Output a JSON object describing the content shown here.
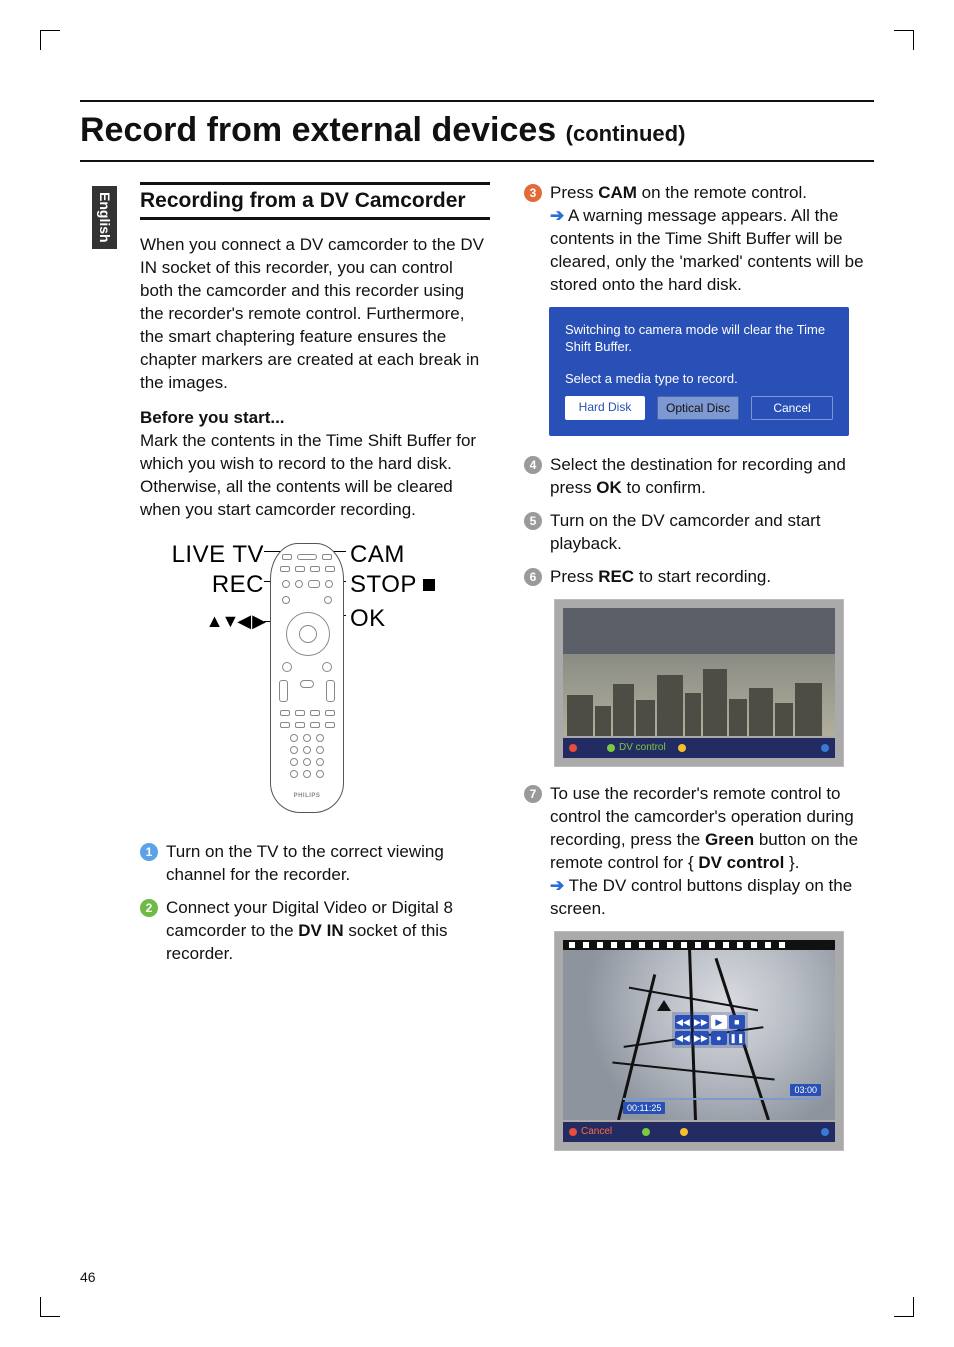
{
  "page": {
    "heading": "Record from external devices",
    "continued": "(continued)",
    "side_tab": "English",
    "page_number": "46"
  },
  "left": {
    "section_title": "Recording from a DV Camcorder",
    "intro": "When you connect a DV camcorder to the DV IN socket of this recorder, you can control both the camcorder and this recorder using the recorder's remote control. Furthermore, the smart chaptering feature ensures the chapter markers are created at each break in the images.",
    "before_title": "Before you start...",
    "before_text": "Mark the contents in the Time Shift Buffer for which you wish to record to the hard disk. Otherwise, all the contents will be cleared when you start camcorder recording.",
    "callouts": {
      "livetv": "LIVE TV",
      "rec": "REC",
      "nav": "▲▼◀ ▶",
      "cam": "CAM",
      "stop": "STOP",
      "ok": "OK"
    },
    "remote_brand": "PHILIPS",
    "step1": "Turn on the TV to the correct viewing channel for the recorder.",
    "step2_a": "Connect your Digital Video or Digital 8 camcorder to the ",
    "step2_b": "DV IN",
    "step2_c": " socket of this recorder."
  },
  "right": {
    "step3_a": "Press ",
    "step3_b": "CAM",
    "step3_c": " on the remote control.",
    "step3_sub": " A warning message appears. All the contents in the Time Shift Buffer will be cleared, only the 'marked' contents will be stored onto the hard disk.",
    "dialog": {
      "line1": "Switching to camera mode will clear the Time Shift Buffer.",
      "line2": "Select a media type to record.",
      "btn_hd": "Hard Disk",
      "btn_od": "Optical Disc",
      "btn_cancel": "Cancel"
    },
    "step4_a": "Select the destination for recording and press ",
    "step4_b": "OK",
    "step4_c": " to confirm.",
    "step5": "Turn on the DV camcorder and start playback.",
    "step6_a": "Press ",
    "step6_b": "REC",
    "step6_c": " to start recording.",
    "dv_bar": "DV control",
    "step7_a": "To use the recorder's remote control to control the camcorder's operation during recording, press the ",
    "step7_b": "Green",
    "step7_c": " button on the remote control for { ",
    "step7_d": "DV control",
    "step7_e": " }.",
    "step7_sub": " The DV control buttons display on the screen.",
    "ctrl": {
      "rw": "◀◀",
      "ff": "▶▶",
      "play": "▶",
      "stop": "■",
      "rec": "●",
      "pause": "❚❚"
    },
    "tc1": "00:11:25",
    "tc2": "03:00",
    "cancel_label": "Cancel"
  }
}
